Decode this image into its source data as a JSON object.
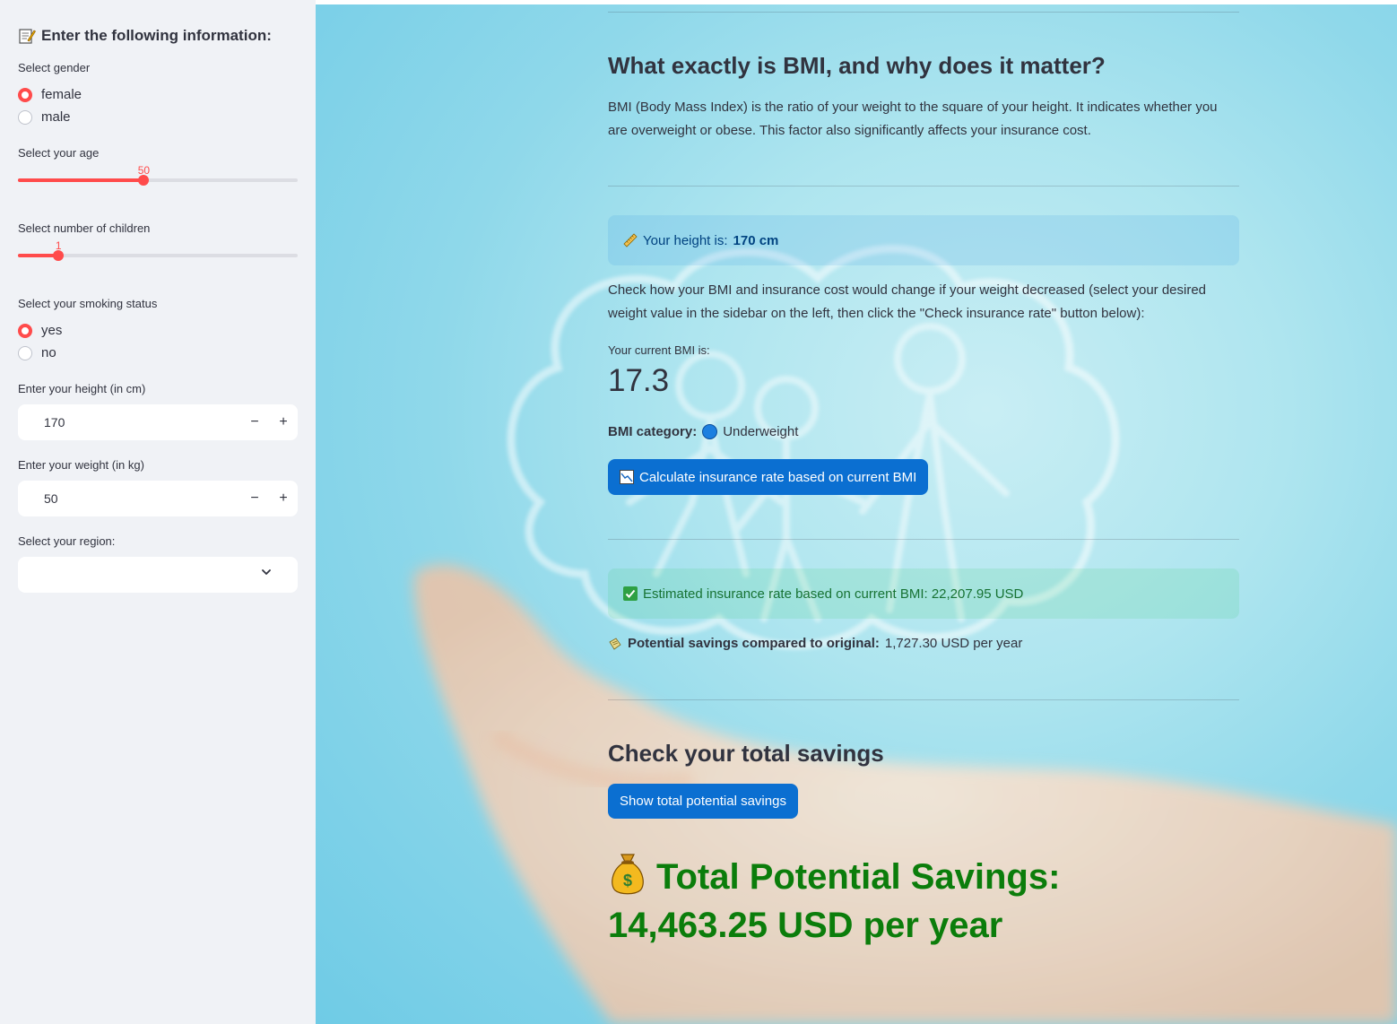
{
  "sidebar": {
    "header": "Enter the following information:",
    "gender": {
      "label": "Select gender",
      "options": [
        "female",
        "male"
      ],
      "selected": "female"
    },
    "age": {
      "label": "Select your age",
      "value": "50",
      "fraction": 0.45
    },
    "children": {
      "label": "Select number of children",
      "value": "1",
      "fraction": 0.145
    },
    "smoking": {
      "label": "Select your smoking status",
      "options": [
        "yes",
        "no"
      ],
      "selected": "yes"
    },
    "height": {
      "label": "Enter your height (in cm)",
      "value": "170",
      "minus": "−",
      "plus": "+"
    },
    "weight": {
      "label": "Enter your weight (in kg)",
      "value": "50",
      "minus": "−",
      "plus": "+"
    },
    "region": {
      "label": "Select your region:",
      "value": ""
    }
  },
  "main": {
    "bmi_heading": "What exactly is BMI, and why does it matter?",
    "bmi_intro": "BMI (Body Mass Index) is the ratio of your weight to the square of your height. It indicates whether you are overweight or obese. This factor also significantly affects your insurance cost.",
    "height_info": {
      "prefix": "Your height is: ",
      "value": "170 cm"
    },
    "check_text": "Check how your BMI and insurance cost would change if your weight decreased (select your desired weight value in the sidebar on the left, then click the \"Check insurance rate\" button below):",
    "bmi_label": "Your current BMI is:",
    "bmi_value": "17.3",
    "bmi_category_label": "BMI category:",
    "bmi_category_value": "Underweight",
    "calc_button": "Calculate insurance rate based on current BMI",
    "estimate_text": "Estimated insurance rate based on current BMI: 22,207.95 USD",
    "savings_label": "Potential savings compared to original:",
    "savings_value": "1,727.30 USD per year",
    "total_heading": "Check your total savings",
    "total_button": "Show total potential savings",
    "total_line1": "Total Potential Savings:",
    "total_line2": "14,463.25 USD per year"
  },
  "colors": {
    "accent": "#ff4b4b",
    "primary_button": "#0b6fd1",
    "success_green": "#0b7d0b",
    "sidebar_bg": "#f0f2f6"
  },
  "icons": [
    "memo-icon",
    "ruler-icon",
    "chart-icon",
    "check-icon",
    "coin-icon",
    "moneybag-icon",
    "chevron-down-icon"
  ]
}
